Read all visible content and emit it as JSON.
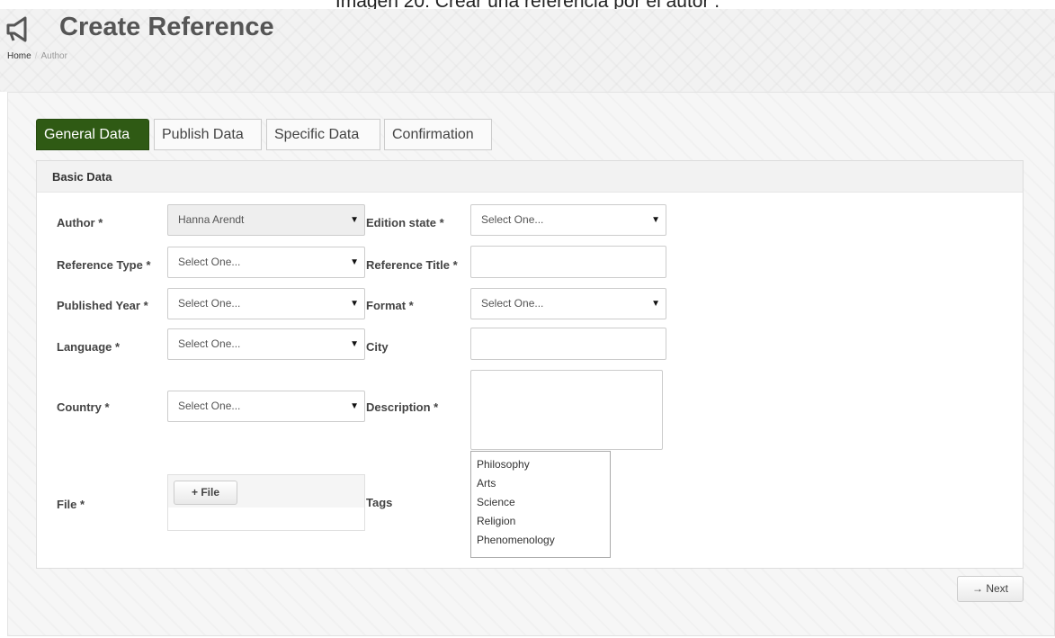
{
  "caption": "Imagen 20: Crear una referencia por el autor .",
  "header": {
    "title": "Create Reference",
    "icon": "megaphone-icon",
    "breadcrumb": {
      "home": "Home",
      "separator": "/",
      "current": "Author"
    }
  },
  "tabs": [
    {
      "label": "General Data",
      "active": true
    },
    {
      "label": "Publish Data",
      "active": false
    },
    {
      "label": "Specific Data",
      "active": false
    },
    {
      "label": "Confirmation",
      "active": false
    }
  ],
  "panel": {
    "title": "Basic Data",
    "fields": {
      "author": {
        "label": "Author *",
        "value": "Hanna Arendt",
        "disabled": true
      },
      "reference_type": {
        "label": "Reference Type *",
        "value": "Select One..."
      },
      "published_year": {
        "label": "Published Year *",
        "value": "Select One..."
      },
      "language": {
        "label": "Language *",
        "value": "Select One..."
      },
      "country": {
        "label": "Country *",
        "value": "Select One..."
      },
      "file": {
        "label": "File *",
        "button": "+ File"
      },
      "edition_state": {
        "label": "Edition state *",
        "value": "Select One..."
      },
      "reference_title": {
        "label": "Reference Title *",
        "value": ""
      },
      "format": {
        "label": "Format *",
        "value": "Select One..."
      },
      "city": {
        "label": "City",
        "value": ""
      },
      "description": {
        "label": "Description *",
        "value": ""
      },
      "tags": {
        "label": "Tags",
        "options": [
          "Philosophy",
          "Arts",
          "Science",
          "Religion",
          "Phenomenology"
        ]
      }
    }
  },
  "next_button": "→ Next",
  "colors": {
    "active_tab": "#2f5a14",
    "panel_header": "#f2f2f2"
  }
}
